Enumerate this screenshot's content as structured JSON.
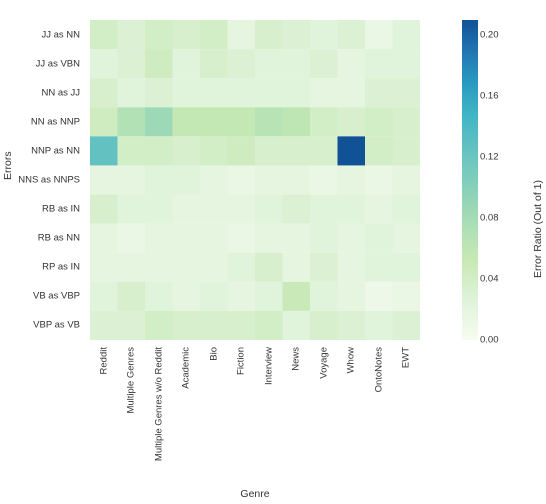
{
  "chart_data": {
    "type": "heatmap",
    "xlabel": "Genre",
    "ylabel": "Errors",
    "colorbar_label": "Error Ratio (Out of 1)",
    "colorbar_ticks": [
      "0.00",
      "0.04",
      "0.08",
      "0.12",
      "0.16",
      "0.20"
    ],
    "x_categories": [
      "Reddit",
      "Multiple Genres",
      "Multiple Genres w/o Reddit",
      "Academic",
      "Bio",
      "Fiction",
      "Interview",
      "News",
      "Voyage",
      "Whow",
      "OntoNotes",
      "EWT"
    ],
    "y_categories": [
      "JJ as NN",
      "JJ as VBN",
      "NN as JJ",
      "NN as NNP",
      "NNP as NN",
      "NNS as NNPS",
      "RB as IN",
      "RB as NN",
      "RP as IN",
      "VB as VBP",
      "VBP as VB"
    ],
    "values": [
      [
        0.04,
        0.03,
        0.04,
        0.035,
        0.04,
        0.02,
        0.035,
        0.03,
        0.025,
        0.03,
        0.015,
        0.025
      ],
      [
        0.025,
        0.03,
        0.045,
        0.025,
        0.035,
        0.03,
        0.025,
        0.025,
        0.03,
        0.02,
        0.025,
        0.025
      ],
      [
        0.035,
        0.025,
        0.03,
        0.025,
        0.025,
        0.025,
        0.025,
        0.025,
        0.02,
        0.02,
        0.03,
        0.03
      ],
      [
        0.045,
        0.07,
        0.085,
        0.055,
        0.055,
        0.055,
        0.065,
        0.06,
        0.04,
        0.035,
        0.04,
        0.035
      ],
      [
        0.125,
        0.04,
        0.04,
        0.035,
        0.04,
        0.045,
        0.035,
        0.035,
        0.035,
        0.21,
        0.04,
        0.035
      ],
      [
        0.02,
        0.02,
        0.025,
        0.025,
        0.02,
        0.015,
        0.02,
        0.02,
        0.015,
        0.02,
        0.015,
        0.02
      ],
      [
        0.035,
        0.025,
        0.025,
        0.02,
        0.02,
        0.02,
        0.025,
        0.03,
        0.025,
        0.025,
        0.02,
        0.025
      ],
      [
        0.02,
        0.015,
        0.02,
        0.02,
        0.02,
        0.015,
        0.02,
        0.02,
        0.025,
        0.02,
        0.025,
        0.02
      ],
      [
        0.02,
        0.02,
        0.02,
        0.02,
        0.02,
        0.025,
        0.035,
        0.02,
        0.03,
        0.02,
        0.025,
        0.025
      ],
      [
        0.025,
        0.035,
        0.025,
        0.02,
        0.025,
        0.02,
        0.025,
        0.05,
        0.025,
        0.02,
        0.01,
        0.015
      ],
      [
        0.03,
        0.03,
        0.04,
        0.035,
        0.035,
        0.035,
        0.04,
        0.025,
        0.035,
        0.03,
        0.025,
        0.03
      ]
    ],
    "vmin": 0.0,
    "vmax": 0.21
  }
}
